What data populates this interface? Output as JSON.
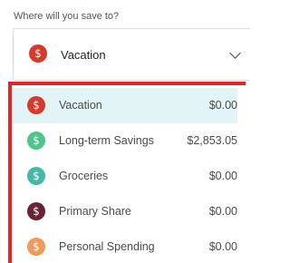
{
  "prompt": {
    "label": "Where will you save to?"
  },
  "select": {
    "selected_label": "Vacation",
    "selected_color": "#d63a2c",
    "currency_glyph": "$"
  },
  "options": [
    {
      "label": "Vacation",
      "amount": "$0.00",
      "color": "#d63a2c",
      "glyph": "$",
      "selected": true
    },
    {
      "label": "Long-term Savings",
      "amount": "$2,853.05",
      "color": "#4fc58a",
      "glyph": "$",
      "selected": false
    },
    {
      "label": "Groceries",
      "amount": "$0.00",
      "color": "#47b8a6",
      "glyph": "$",
      "selected": false
    },
    {
      "label": "Primary Share",
      "amount": "$0.00",
      "color": "#6b2233",
      "glyph": "$",
      "selected": false
    },
    {
      "label": "Personal Spending",
      "amount": "$0.00",
      "color": "#ef9a5b",
      "glyph": "$",
      "selected": false
    }
  ],
  "colors": {
    "highlight_border": "#e4232a",
    "selected_row_bg": "#e2f4f5"
  }
}
